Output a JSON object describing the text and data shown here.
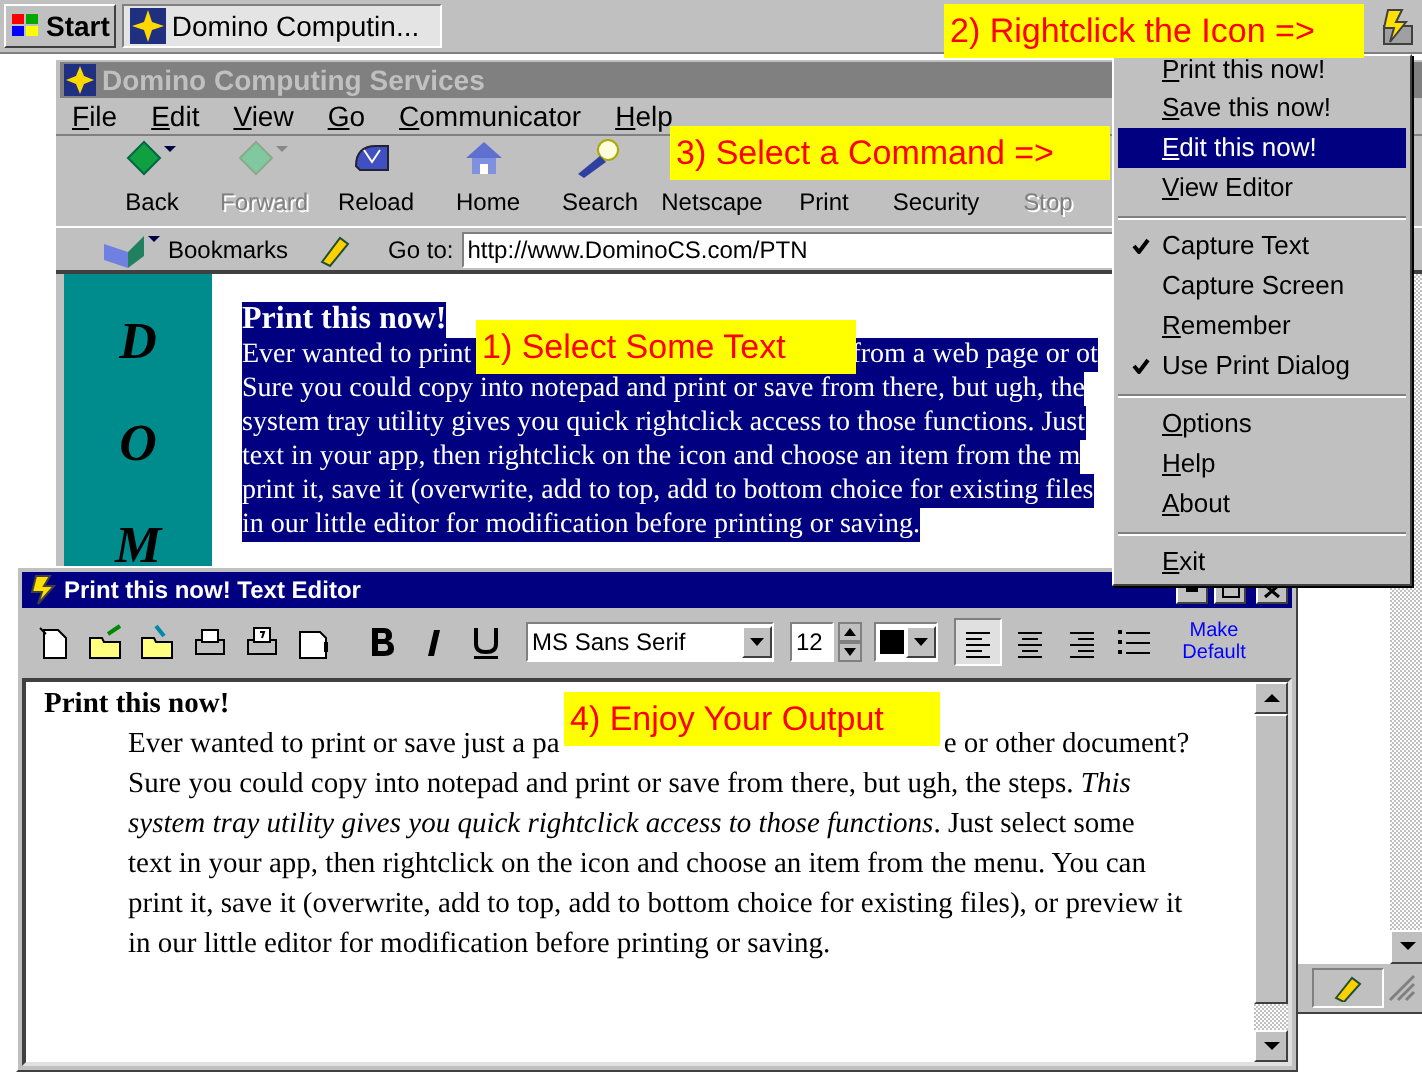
{
  "taskbar": {
    "start": "Start",
    "tasks": [
      {
        "label": "Domino Computin...",
        "selected": true
      }
    ]
  },
  "browser": {
    "title": "Domino Computing Services",
    "active": false,
    "menu": [
      "File",
      "Edit",
      "View",
      "Go",
      "Communicator",
      "Help"
    ],
    "toolbar": [
      {
        "label": "Back",
        "disabled": false
      },
      {
        "label": "Forward",
        "disabled": true
      },
      {
        "label": "Reload",
        "disabled": false
      },
      {
        "label": "Home",
        "disabled": false
      },
      {
        "label": "Search",
        "disabled": false
      },
      {
        "label": "Netscape",
        "disabled": false
      },
      {
        "label": "Print",
        "disabled": false
      },
      {
        "label": "Security",
        "disabled": false
      },
      {
        "label": "Stop",
        "disabled": true
      }
    ],
    "bookmarks": "Bookmarks",
    "goto_label": "Go to:",
    "url": "http://www.DominoCS.com/PTN",
    "side_letters": [
      "D",
      "O",
      "M"
    ],
    "page": {
      "selected": true,
      "heading": "Print this now!",
      "lines": [
        [
          "Ever wanted to print",
          "from a web page or ot"
        ],
        [
          "Sure you could copy into notepad and print or save from there, but ugh, the"
        ],
        [
          "system tray utility gives you quick rightclick access to those functions. Just"
        ],
        [
          "text in your app, then rightclick on the icon and choose an item from the m"
        ],
        [
          "print it, save it (overwrite, add to top, add to bottom choice for existing files"
        ],
        [
          "in our little editor for modification before printing or saving."
        ]
      ]
    }
  },
  "context_menu": [
    {
      "kind": "item",
      "label": "Print this now!",
      "checked": false,
      "selected": false,
      "mnemonic": true
    },
    {
      "kind": "item",
      "label": "Save this now!",
      "checked": false,
      "selected": false,
      "mnemonic": true
    },
    {
      "kind": "item",
      "label": "Edit this now!",
      "checked": false,
      "selected": true,
      "mnemonic": true
    },
    {
      "kind": "item",
      "label": "View Editor",
      "checked": false,
      "selected": false,
      "mnemonic": true
    },
    {
      "kind": "separator"
    },
    {
      "kind": "item",
      "label": "Capture Text",
      "checked": true,
      "selected": false,
      "mnemonic": false
    },
    {
      "kind": "item",
      "label": "Capture Screen",
      "checked": false,
      "selected": false,
      "mnemonic": false
    },
    {
      "kind": "item",
      "label": "Remember",
      "checked": false,
      "selected": false,
      "mnemonic": true
    },
    {
      "kind": "item",
      "label": "Use Print Dialog",
      "checked": true,
      "selected": false,
      "mnemonic": false
    },
    {
      "kind": "separator"
    },
    {
      "kind": "item",
      "label": "Options",
      "checked": false,
      "selected": false,
      "mnemonic": true
    },
    {
      "kind": "item",
      "label": "Help",
      "checked": false,
      "selected": false,
      "mnemonic": true
    },
    {
      "kind": "item",
      "label": "About",
      "checked": false,
      "selected": false,
      "mnemonic": true
    },
    {
      "kind": "separator"
    },
    {
      "kind": "item",
      "label": "Exit",
      "checked": false,
      "selected": false,
      "mnemonic": true
    }
  ],
  "editor": {
    "title": "Print this now! Text Editor",
    "active": true,
    "font": "MS Sans Serif",
    "size": "12",
    "make_default": "Make Default",
    "align_buttons": [
      {
        "selected": true
      },
      {
        "selected": false
      },
      {
        "selected": false
      }
    ],
    "heading": "Print this now!",
    "lines": [
      [
        "Ever wanted to print or save just a pa",
        "e or other document?"
      ],
      [
        "Sure you could copy into notepad and print or save from there, but ugh, the steps. *This*"
      ],
      [
        "*system tray utility gives you quick rightclick access to those functions*. Just select some"
      ],
      [
        "text in your app, then rightclick on the icon and choose an item from the menu.  You can"
      ],
      [
        "print it, save it (overwrite, add to top, add to bottom choice for existing files), or preview it"
      ],
      [
        "in our little editor for modification before printing or saving."
      ]
    ]
  },
  "callouts": [
    "1) Select Some Text",
    "2) Rightclick the Icon =>",
    "3) Select a Command =>",
    "4) Enjoy Your Output"
  ]
}
